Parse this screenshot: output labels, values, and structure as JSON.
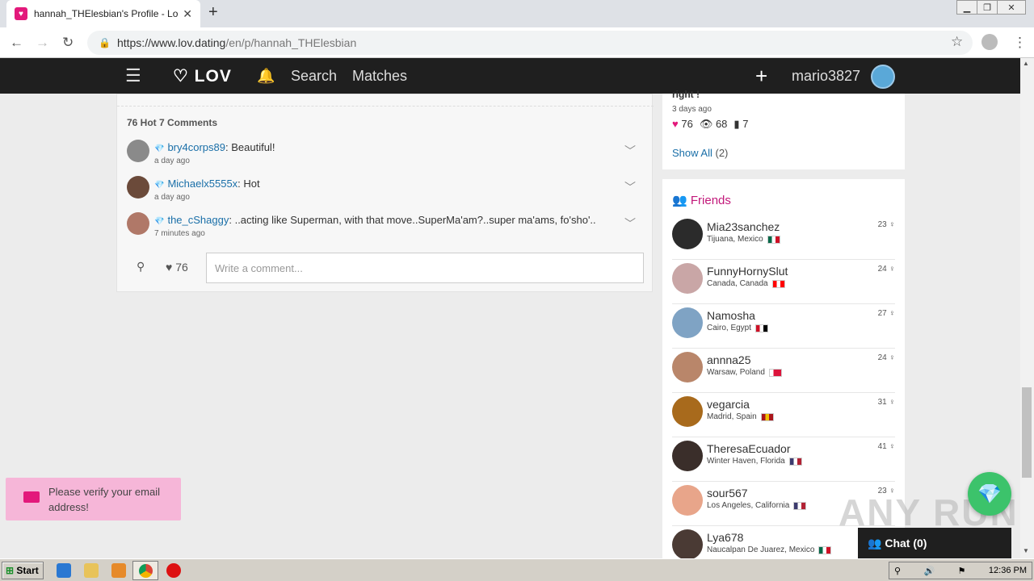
{
  "browser": {
    "tab_title": "hannah_THElesbian's Profile - Lov",
    "url_domain": "https://www.lov.dating",
    "url_path": "/en/p/hannah_THElesbian"
  },
  "header": {
    "logo": "LOV",
    "nav_search": "Search",
    "nav_matches": "Matches",
    "username": "mario3827"
  },
  "post": {
    "stats": "76 Hot  7 Comments",
    "comments": [
      {
        "user": "bry4corps89",
        "text": ": Beautiful!",
        "time": "a day ago",
        "avatar_color": "#8a8a8a"
      },
      {
        "user": "Michaelx5555x",
        "text": ": Hot",
        "time": "a day ago",
        "avatar_color": "#6b4a3a"
      },
      {
        "user": "the_cShaggy",
        "text": ": ..acting like Superman, with that move..SuperMa'am?..super ma'ams, fo'sho'..",
        "time": "7 minutes ago",
        "avatar_color": "#b07868"
      }
    ],
    "like_count": "76",
    "comment_placeholder": "Write a comment..."
  },
  "side_post": {
    "title_fragment": "right !",
    "time": "3 days ago",
    "hearts": "76",
    "views": "68",
    "comments": "7",
    "show_all": "Show All",
    "show_all_count": "(2)"
  },
  "friends": {
    "title": "Friends",
    "items": [
      {
        "name": "Mia23sanchez",
        "location": "Tijuana, Mexico",
        "age": "23 ♀",
        "avatar_color": "#2b2b2b",
        "flag": [
          "#006847",
          "#ffffff",
          "#ce1126"
        ]
      },
      {
        "name": "FunnyHornySlut",
        "location": "Canada, Canada",
        "age": "24 ♀",
        "avatar_color": "#c9a6a6",
        "flag": [
          "#ff0000",
          "#ffffff",
          "#ff0000"
        ]
      },
      {
        "name": "Namosha",
        "location": "Cairo, Egypt",
        "age": "27 ♀",
        "avatar_color": "#7fa3c4",
        "flag": [
          "#ce1126",
          "#ffffff",
          "#000000"
        ]
      },
      {
        "name": "annna25",
        "location": "Warsaw, Poland",
        "age": "24 ♀",
        "avatar_color": "#b9866a",
        "flag": [
          "#ffffff",
          "#dc143c",
          "#dc143c"
        ]
      },
      {
        "name": "vegarcia",
        "location": "Madrid, Spain",
        "age": "31 ♀",
        "avatar_color": "#a86a1c",
        "flag": [
          "#aa151b",
          "#f1bf00",
          "#aa151b"
        ]
      },
      {
        "name": "TheresaEcuador",
        "location": "Winter Haven, Florida",
        "age": "41 ♀",
        "avatar_color": "#3a2e2a",
        "flag": [
          "#3c3b6e",
          "#ffffff",
          "#b22234"
        ]
      },
      {
        "name": "sour567",
        "location": "Los Angeles, California",
        "age": "23 ♀",
        "avatar_color": "#e8a58a",
        "flag": [
          "#3c3b6e",
          "#ffffff",
          "#b22234"
        ]
      },
      {
        "name": "Lya678",
        "location": "Naucalpan De Juarez, Mexico",
        "age": "",
        "avatar_color": "#4a3a34",
        "flag": [
          "#006847",
          "#ffffff",
          "#ce1126"
        ]
      }
    ]
  },
  "toast": {
    "text": "Please verify your email address!"
  },
  "chat": {
    "label": "Chat (0)"
  },
  "watermark": "ANY RUN",
  "taskbar": {
    "start": "Start",
    "clock": "12:36 PM"
  }
}
